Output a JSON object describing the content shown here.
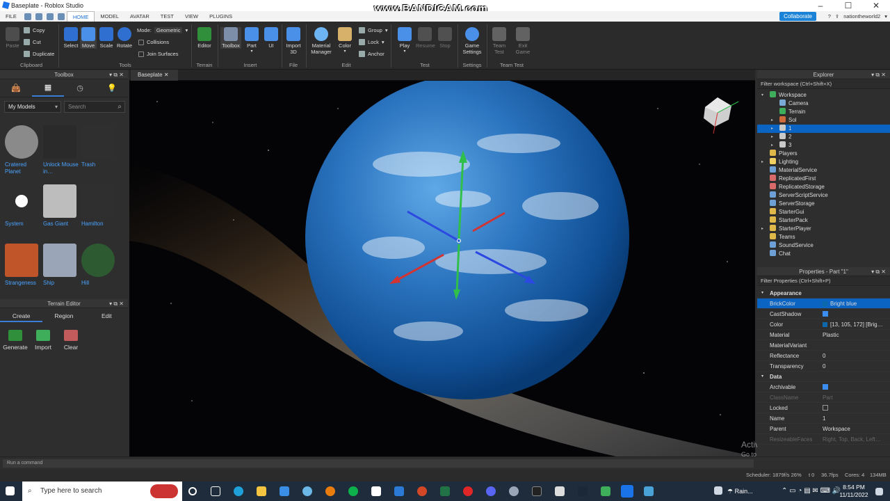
{
  "window": {
    "title": "Baseplate - Roblox Studio",
    "watermark": "www.BANDICAM.com"
  },
  "menu": {
    "items": [
      "FILE",
      "HOME",
      "MODEL",
      "AVATAR",
      "TEST",
      "VIEW",
      "PLUGINS"
    ],
    "active": "HOME",
    "collaborate": "Collaborate",
    "user": "nationtheworld2"
  },
  "ribbon": {
    "clipboard": {
      "paste": "Paste",
      "copy": "Copy",
      "cut": "Cut",
      "duplicate": "Duplicate",
      "group": "Clipboard"
    },
    "tools": {
      "select": "Select",
      "move": "Move",
      "scale": "Scale",
      "rotate": "Rotate",
      "mode_label": "Mode:",
      "mode_value": "Geometric",
      "collisions": "Collisions",
      "join_surfaces": "Join Surfaces",
      "group": "Tools"
    },
    "terrain": {
      "editor": "Editor",
      "group": "Terrain"
    },
    "insert": {
      "toolbox": "Toolbox",
      "part": "Part",
      "ui": "UI",
      "group": "Insert"
    },
    "file": {
      "import3d": "Import 3D",
      "group": "File"
    },
    "edit": {
      "material": "Material Manager",
      "color": "Color",
      "group_btn": "Group",
      "lock": "Lock",
      "anchor": "Anchor",
      "group": "Edit"
    },
    "test": {
      "play": "Play",
      "resume": "Resume",
      "stop": "Stop",
      "group": "Test"
    },
    "settings": {
      "game": "Game Settings",
      "group": "Settings"
    },
    "teamtest": {
      "team": "Team Test",
      "exit": "Exit Game",
      "group": "Team Test"
    }
  },
  "toolbox": {
    "title": "Toolbox",
    "category": "My Models",
    "search_placeholder": "Search",
    "assets": [
      {
        "name": "Cratered Planet",
        "color": "#8a8a8a"
      },
      {
        "name": "Unlock Mouse in…",
        "color": "#2a2a2a"
      },
      {
        "name": "Trash",
        "color": "#2f2f2f"
      },
      {
        "name": "System",
        "color": "#ffffff"
      },
      {
        "name": "Gas Giant",
        "color": "#bdbdbd"
      },
      {
        "name": "Hamilton",
        "color": "#2f2f2f"
      },
      {
        "name": "Strangeness",
        "color": "#c0552a"
      },
      {
        "name": "Ship",
        "color": "#9aa6b8"
      },
      {
        "name": "Hill",
        "color": "#2e5a32"
      }
    ]
  },
  "terrain_editor": {
    "title": "Terrain Editor",
    "tabs": [
      "Create",
      "Region",
      "Edit"
    ],
    "tools": [
      "Generate",
      "Import",
      "Clear"
    ]
  },
  "doc_tab": {
    "label": "Baseplate"
  },
  "explorer": {
    "title": "Explorer",
    "filter": "Filter workspace (Ctrl+Shift+X)",
    "items": [
      {
        "label": "Workspace",
        "depth": 0,
        "arrow": "▾",
        "color": "#3fae5a"
      },
      {
        "label": "Camera",
        "depth": 1,
        "arrow": "",
        "color": "#7aa9d6"
      },
      {
        "label": "Terrain",
        "depth": 1,
        "arrow": "",
        "color": "#3fae5a"
      },
      {
        "label": "Sol",
        "depth": 1,
        "arrow": "▸",
        "color": "#d06a3a"
      },
      {
        "label": "1",
        "depth": 1,
        "arrow": "▸",
        "color": "#c9c9c9",
        "selected": true
      },
      {
        "label": "2",
        "depth": 1,
        "arrow": "▸",
        "color": "#c9c9c9"
      },
      {
        "label": "3",
        "depth": 1,
        "arrow": "▸",
        "color": "#c9c9c9"
      },
      {
        "label": "Players",
        "depth": 0,
        "arrow": "",
        "color": "#e0b84a"
      },
      {
        "label": "Lighting",
        "depth": 0,
        "arrow": "▸",
        "color": "#f0d060"
      },
      {
        "label": "MaterialService",
        "depth": 0,
        "arrow": "",
        "color": "#6ea0d8"
      },
      {
        "label": "ReplicatedFirst",
        "depth": 0,
        "arrow": "",
        "color": "#d86a6a"
      },
      {
        "label": "ReplicatedStorage",
        "depth": 0,
        "arrow": "",
        "color": "#d86a6a"
      },
      {
        "label": "ServerScriptService",
        "depth": 0,
        "arrow": "",
        "color": "#6ea0d8"
      },
      {
        "label": "ServerStorage",
        "depth": 0,
        "arrow": "",
        "color": "#6ea0d8"
      },
      {
        "label": "StarterGui",
        "depth": 0,
        "arrow": "",
        "color": "#e0b84a"
      },
      {
        "label": "StarterPack",
        "depth": 0,
        "arrow": "",
        "color": "#e0b84a"
      },
      {
        "label": "StarterPlayer",
        "depth": 0,
        "arrow": "▸",
        "color": "#e0b84a"
      },
      {
        "label": "Teams",
        "depth": 0,
        "arrow": "",
        "color": "#e0b84a"
      },
      {
        "label": "SoundService",
        "depth": 0,
        "arrow": "",
        "color": "#6ea0d8"
      },
      {
        "label": "Chat",
        "depth": 0,
        "arrow": "",
        "color": "#6ea0d8"
      }
    ]
  },
  "properties": {
    "title": "Properties - Part \"1\"",
    "filter": "Filter Properties (Ctrl+Shift+P)",
    "rows": [
      {
        "cat": true,
        "key": "Appearance"
      },
      {
        "key": "BrickColor",
        "value": "Bright blue",
        "swatch": "#0d69ac",
        "selected": true
      },
      {
        "key": "CastShadow",
        "check": true
      },
      {
        "key": "Color",
        "value": "[13, 105, 172] [Brig…",
        "swatch": "#0d69ac"
      },
      {
        "key": "Material",
        "value": "Plastic"
      },
      {
        "key": "MaterialVariant",
        "value": ""
      },
      {
        "key": "Reflectance",
        "value": "0"
      },
      {
        "key": "Transparency",
        "value": "0"
      },
      {
        "cat": true,
        "key": "Data"
      },
      {
        "key": "Archivable",
        "check": true
      },
      {
        "key": "ClassName",
        "value": "Part",
        "dim": true
      },
      {
        "key": "Locked",
        "check": false
      },
      {
        "key": "Name",
        "value": "1"
      },
      {
        "key": "Parent",
        "value": "Workspace"
      },
      {
        "key": "ResizeableFaces",
        "value": "Right, Top, Back, Left…",
        "dim": true
      }
    ]
  },
  "command_bar": {
    "placeholder": "Run a command"
  },
  "status": {
    "scheduler": "Scheduler: 1879f/s 26%",
    "t": "t 0",
    "fps": "36.7fps",
    "cores": "Cores: 4",
    "mem": "134MB"
  },
  "activate": {
    "line1": "Activate Windows",
    "line2": "Go to Settings to activate Windows."
  },
  "taskbar": {
    "search": "Type here to search",
    "weather": "Rain...",
    "time": "8:54 PM",
    "date": "11/11/2022"
  }
}
